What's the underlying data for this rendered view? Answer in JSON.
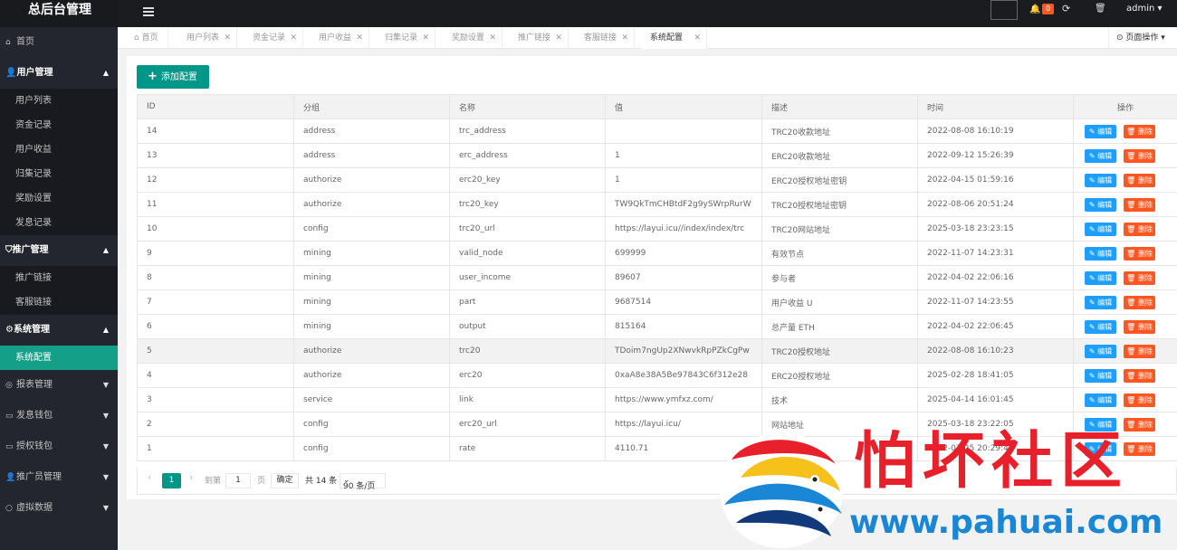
{
  "app": {
    "title": "总后台管理"
  },
  "topbar": {
    "badge": "0",
    "user": "admin ▾"
  },
  "sidebar": {
    "home": "首页",
    "groups": [
      {
        "label": "用户管理",
        "children": [
          "用户列表",
          "资金记录",
          "用户收益",
          "归集记录",
          "奖励设置",
          "发息记录"
        ]
      },
      {
        "label": "推广管理",
        "children": [
          "推广链接",
          "客服链接"
        ]
      },
      {
        "label": "系统管理",
        "children": [
          "系统配置"
        ]
      }
    ],
    "items": [
      "报表管理",
      "发息钱包",
      "授权钱包",
      "推广员管理",
      "虚拟数据"
    ]
  },
  "tabs": [
    {
      "label": "首页"
    },
    {
      "label": "用户列表"
    },
    {
      "label": "资金记录"
    },
    {
      "label": "用户收益"
    },
    {
      "label": "归集记录"
    },
    {
      "label": "奖励设置"
    },
    {
      "label": "推广链接"
    },
    {
      "label": "客服链接"
    },
    {
      "label": "系统配置"
    }
  ],
  "page_op": "页面操作",
  "add_button": "添加配置",
  "table": {
    "headers": [
      "ID",
      "分组",
      "名称",
      "值",
      "描述",
      "时间",
      "操作"
    ],
    "edit_label": "编辑",
    "delete_label": "删除",
    "rows": [
      [
        "14",
        "address",
        "trc_address",
        "",
        "TRC20收款地址",
        "2022-08-08 16:10:19"
      ],
      [
        "13",
        "address",
        "erc_address",
        "1",
        "ERC20收款地址",
        "2022-09-12 15:26:39"
      ],
      [
        "12",
        "authorize",
        "erc20_key",
        "1",
        "ERC20授权地址密钥",
        "2022-04-15 01:59:16"
      ],
      [
        "11",
        "authorize",
        "trc20_key",
        "TW9QkTmCHBtdF2g9ySWrpRurW",
        "TRC20授权地址密钥",
        "2022-08-06 20:51:24"
      ],
      [
        "10",
        "config",
        "trc20_url",
        "https://layui.icu//index/index/trc",
        "TRC20网站地址",
        "2025-03-18 23:23:15"
      ],
      [
        "9",
        "mining",
        "valid_node",
        "699999",
        "有效节点",
        "2022-11-07 14:23:31"
      ],
      [
        "8",
        "mining",
        "user_income",
        "89607",
        "参与者",
        "2022-04-02 22:06:16"
      ],
      [
        "7",
        "mining",
        "part",
        "9687514",
        "用户收益 U",
        "2022-11-07 14:23:55"
      ],
      [
        "6",
        "mining",
        "output",
        "815164",
        "总产量 ETH",
        "2022-04-02 22:06:45"
      ],
      [
        "5",
        "authorize",
        "trc20",
        "TDoim7ngUp2XNwvkRpPZkCgPw",
        "TRC20授权地址",
        "2022-08-08 16:10:23"
      ],
      [
        "4",
        "authorize",
        "erc20",
        "0xaA8e38A5Be97843C6f312e28",
        "ERC20授权地址",
        "2025-02-28 18:41:05"
      ],
      [
        "3",
        "service",
        "link",
        "https://www.ymfxz.com/",
        "技术",
        "2025-04-14 16:01:45"
      ],
      [
        "2",
        "config",
        "erc20_url",
        "https://layui.icu/",
        "网站地址",
        "2025-03-18 23:22:05"
      ],
      [
        "1",
        "config",
        "rate",
        "4110.71",
        "",
        "2022-07-25 20:29:44"
      ]
    ]
  },
  "pager": {
    "current": "1",
    "goto_label": "到第",
    "input_value": "1",
    "page_label": "页",
    "ok_label": "确定",
    "total": "共 14 条",
    "page_size": "90 条/页"
  },
  "watermark": {
    "title": "怕坏社区",
    "url": "www.pahuai.com"
  }
}
